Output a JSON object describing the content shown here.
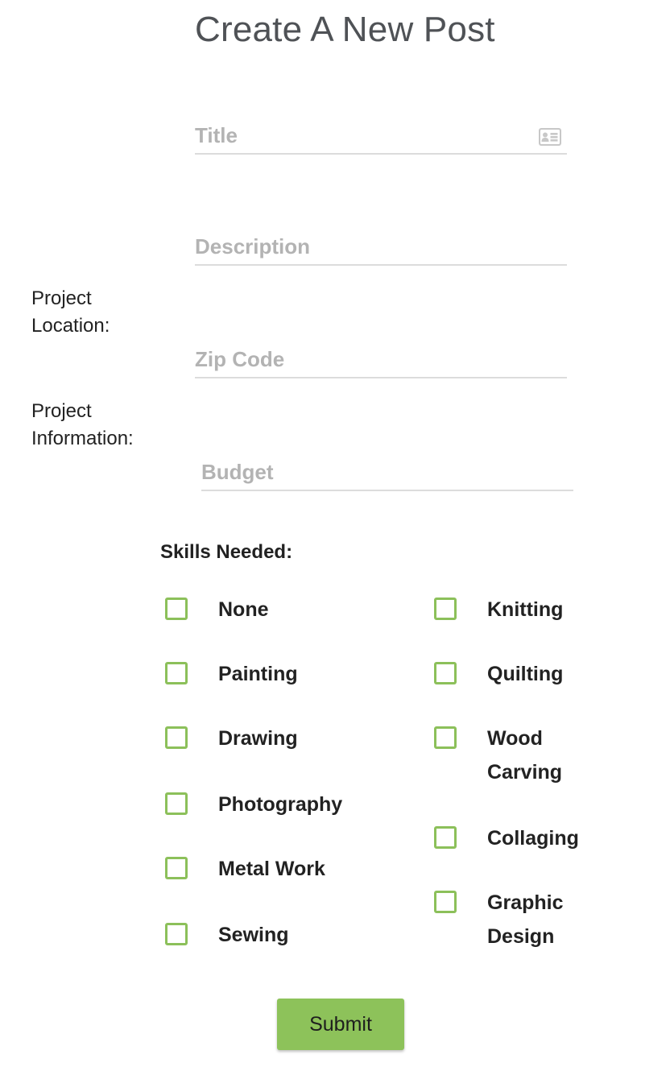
{
  "page": {
    "title": "Create A New Post"
  },
  "form": {
    "title_field": {
      "placeholder": "Title",
      "value": "",
      "icon": "id-card-icon"
    },
    "description_field": {
      "placeholder": "Description",
      "value": ""
    },
    "location_label": "Project Location:",
    "zip_field": {
      "placeholder": "Zip Code",
      "value": ""
    },
    "information_label": "Project Information:",
    "budget_field": {
      "placeholder": "Budget",
      "value": ""
    }
  },
  "skills": {
    "heading": "Skills Needed:",
    "left_column": [
      {
        "label": "None",
        "checked": false
      },
      {
        "label": "Painting",
        "checked": false
      },
      {
        "label": "Drawing",
        "checked": false
      },
      {
        "label": "Photography",
        "checked": false
      },
      {
        "label": "Metal Work",
        "checked": false
      },
      {
        "label": "Sewing",
        "checked": false
      }
    ],
    "right_column": [
      {
        "label": "Knitting",
        "checked": false
      },
      {
        "label": "Quilting",
        "checked": false
      },
      {
        "label": "Wood Carving",
        "checked": false
      },
      {
        "label": "Collaging",
        "checked": false
      },
      {
        "label": "Graphic Design",
        "checked": false
      }
    ]
  },
  "submit_label": "Submit",
  "colors": {
    "accent_green": "#8dc25a",
    "title_gray": "#4f5256",
    "placeholder_gray": "#b3b3b3",
    "underline_gray": "#dcdcdc"
  }
}
